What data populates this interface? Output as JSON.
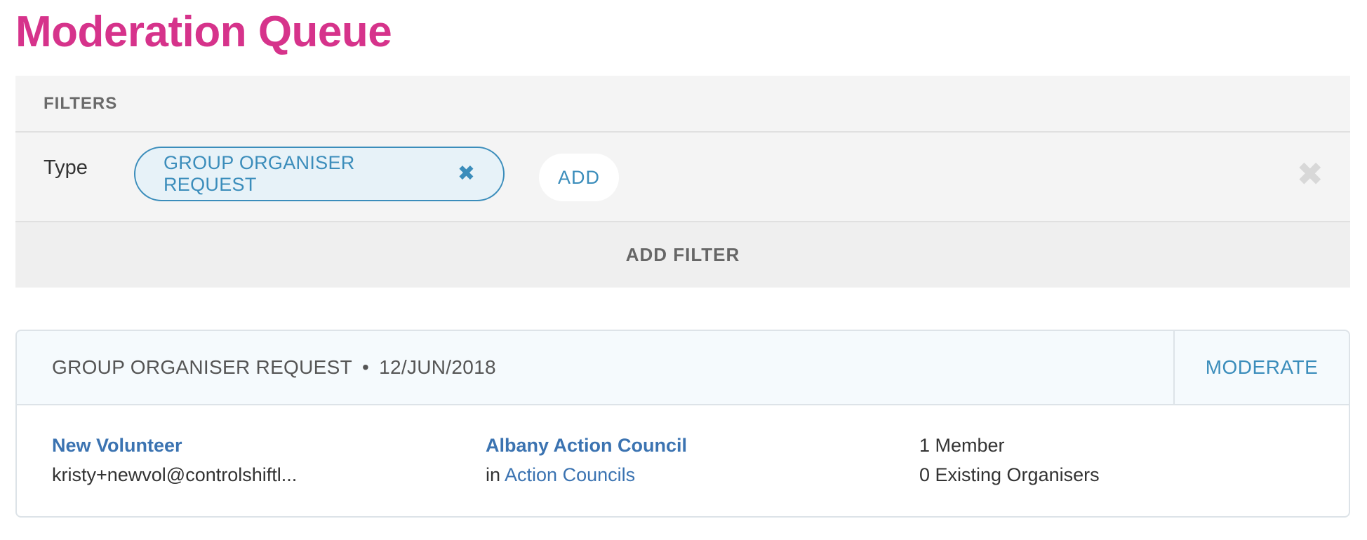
{
  "page": {
    "title": "Moderation Queue"
  },
  "filters": {
    "heading": "FILTERS",
    "rows": [
      {
        "label": "Type",
        "chips": [
          {
            "label": "GROUP ORGANISER REQUEST",
            "remove_icon": "close-icon"
          }
        ],
        "add_label": "ADD",
        "clear_icon": "close-icon"
      }
    ],
    "add_filter_label": "ADD FILTER"
  },
  "requests": [
    {
      "type": "GROUP ORGANISER REQUEST",
      "separator": "•",
      "date": "12/JUN/2018",
      "action_label": "MODERATE",
      "requester": {
        "name": "New Volunteer",
        "email": "kristy+newvol@controlshiftl..."
      },
      "group": {
        "name": "Albany Action Council",
        "prefix": "in",
        "category": "Action Councils"
      },
      "stats": {
        "members": "1 Member",
        "organisers": "0 Existing Organisers"
      }
    }
  ],
  "colors": {
    "title": "#d6338b",
    "accent": "#3b8dbb",
    "link": "#3b73b1",
    "panel_bg": "#f4f4f4",
    "card_header_bg": "#f5fafd"
  }
}
